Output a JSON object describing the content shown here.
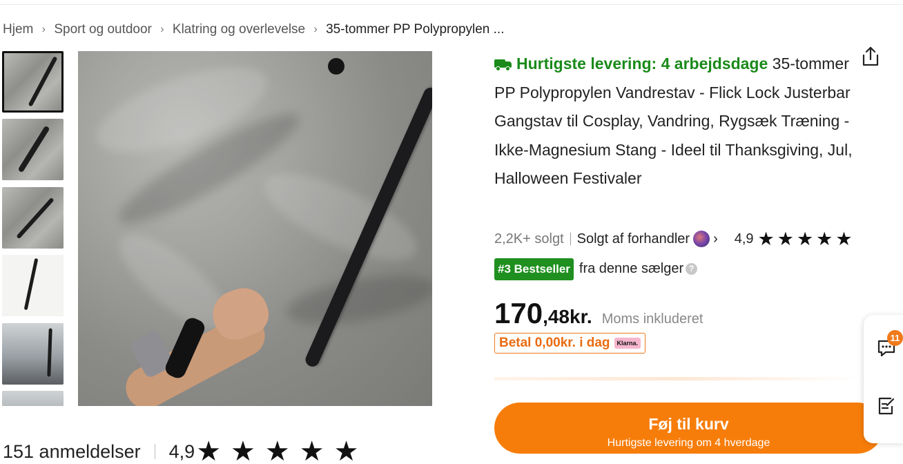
{
  "breadcrumb": {
    "items": [
      "Hjem",
      "Sport og outdoor",
      "Klatring og overlevelse",
      "35-tommer PP Polypropylen ..."
    ]
  },
  "gallery": {
    "thumbnail_count": 6,
    "active_index": 0
  },
  "product": {
    "fast_delivery_label": "Hurtigste levering: 4 arbejdsdage",
    "title": "35-tommer PP Polypropylen Vandrestav - Flick Lock Justerbar Gangstav til Cosplay, Vandring, Rygsæk Træning - Ikke-Magnesium Stang - Ideel til Thanksgiving, Jul, Halloween Festivaler",
    "sold": "2,2K+ solgt",
    "seller": "Solgt af forhandler",
    "rating": "4,9",
    "stars": "★★★★★",
    "bestseller_badge": "#3 Bestseller",
    "bestseller_text": "fra denne sælger",
    "price_int": "170",
    "price_dec": ",48kr.",
    "vat_note": "Moms inkluderet",
    "klarna_text": "Betal 0,00kr. i dag",
    "klarna_logo": "Klarna."
  },
  "cart": {
    "button_label": "Føj til kurv",
    "button_sub": "Hurtigste levering om 4 hverdage"
  },
  "reviews": {
    "count_label": "151 anmeldelser",
    "score": "4,9",
    "stars": "★★★★★"
  },
  "side_panel": {
    "notification_count": "11"
  },
  "colors": {
    "accent_green": "#1a8a1a",
    "cart_orange": "#f77d0a",
    "klarna_pink": "#f5b6ce"
  }
}
